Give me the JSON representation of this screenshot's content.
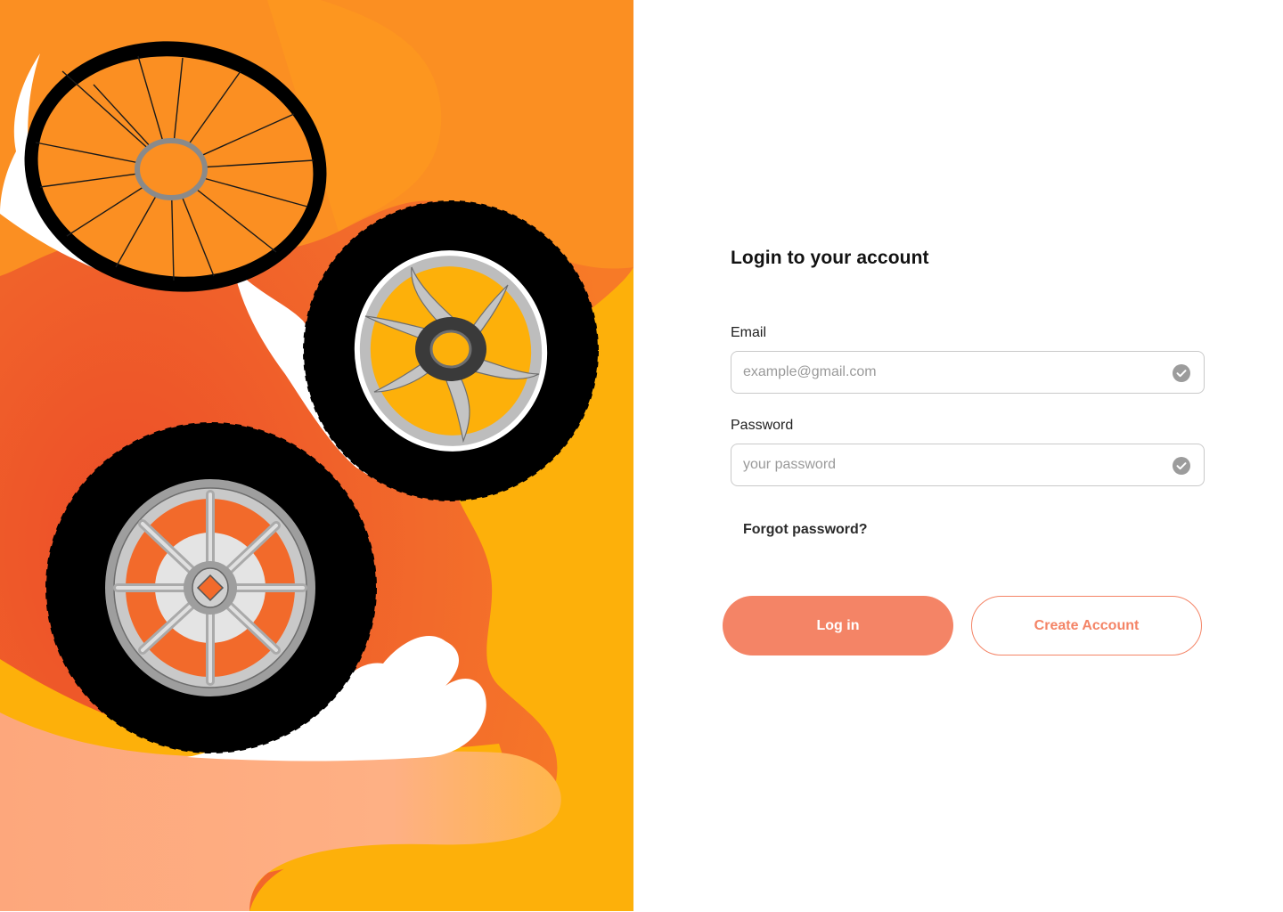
{
  "login": {
    "title": "Login to your account",
    "email": {
      "label": "Email",
      "placeholder": "example@gmail.com",
      "value": "",
      "icon": "check-circle-icon"
    },
    "password": {
      "label": "Password",
      "placeholder": "your password",
      "value": "",
      "icon": "check-circle-icon"
    },
    "forgot_label": "Forgot password?",
    "login_label": "Log in",
    "create_label": "Create Account"
  },
  "hero": {
    "illustration": "tire-wheels-illustration"
  },
  "colors": {
    "accent": "#f48466",
    "orange": "#fb8c22",
    "red_orange": "#ee5a2c",
    "yellow": "#fdb00a",
    "peach": "#feb586"
  }
}
